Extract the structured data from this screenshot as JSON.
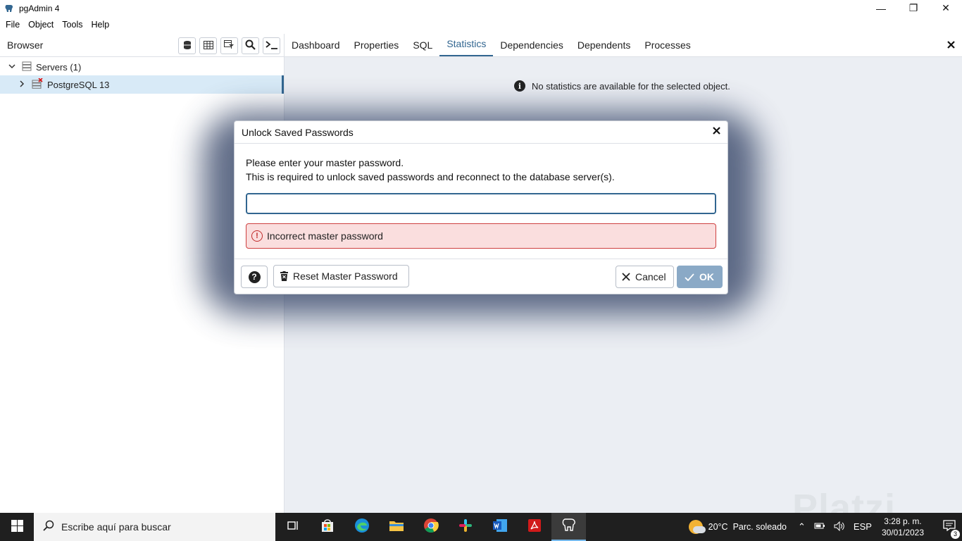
{
  "window": {
    "title": "pgAdmin 4",
    "minimize_glyph": "—",
    "restore_glyph": "❐",
    "close_glyph": "✕"
  },
  "menu": [
    "File",
    "Object",
    "Tools",
    "Help"
  ],
  "browser": {
    "title": "Browser",
    "tree": {
      "servers_label": "Servers (1)",
      "server_label": "PostgreSQL 13"
    }
  },
  "tabs": [
    "Dashboard",
    "Properties",
    "SQL",
    "Statistics",
    "Dependencies",
    "Dependents",
    "Processes"
  ],
  "active_tab": "Statistics",
  "statistics": {
    "message": "No statistics are available for the selected object."
  },
  "dialog": {
    "title": "Unlock Saved Passwords",
    "line1": "Please enter your master password.",
    "line2": "This is required to unlock saved passwords and reconnect to the database server(s).",
    "password_value": "",
    "error": "Incorrect master password",
    "reset_label": "Reset Master Password",
    "cancel_label": "Cancel",
    "ok_label": "OK"
  },
  "taskbar": {
    "search_placeholder": "Escribe aquí para buscar",
    "weather_temp": "20°C",
    "weather_desc": "Parc. soleado",
    "language": "ESP",
    "time": "3:28 p. m.",
    "date": "30/01/2023",
    "notification_count": "3"
  },
  "watermark": "Platzi",
  "colors": {
    "accent": "#326690",
    "error_bg": "#fadede",
    "error_border": "#ce4040",
    "ok_button": "#8aa9c6"
  }
}
